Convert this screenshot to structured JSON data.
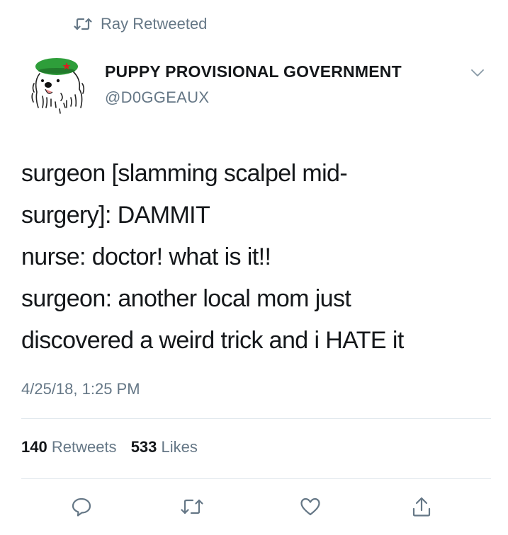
{
  "context": {
    "text": "Ray Retweeted",
    "icon": "retweet-icon"
  },
  "author": {
    "display_name": "PUPPY PROVISIONAL GOVERNMENT",
    "handle": "@D0GGEAUX",
    "avatar": "dog-with-green-beret-avatar"
  },
  "tweet": {
    "lines": [
      "surgeon [slamming scalpel mid-",
      "surgery]: DAMMIT",
      "nurse: doctor! what is it!!",
      "surgeon: another local mom just",
      "discovered a weird trick and i HATE it"
    ],
    "timestamp": "4/25/18, 1:25 PM"
  },
  "stats": {
    "retweets_count": "140",
    "retweets_label": "Retweets",
    "likes_count": "533",
    "likes_label": "Likes"
  },
  "actions": [
    "reply-icon",
    "retweet-icon",
    "like-icon",
    "share-icon"
  ],
  "colors": {
    "text": "#14171a",
    "secondary": "#657786",
    "divider": "#e1e8ed",
    "beret": "#2e9e3a",
    "star": "#d42020"
  }
}
